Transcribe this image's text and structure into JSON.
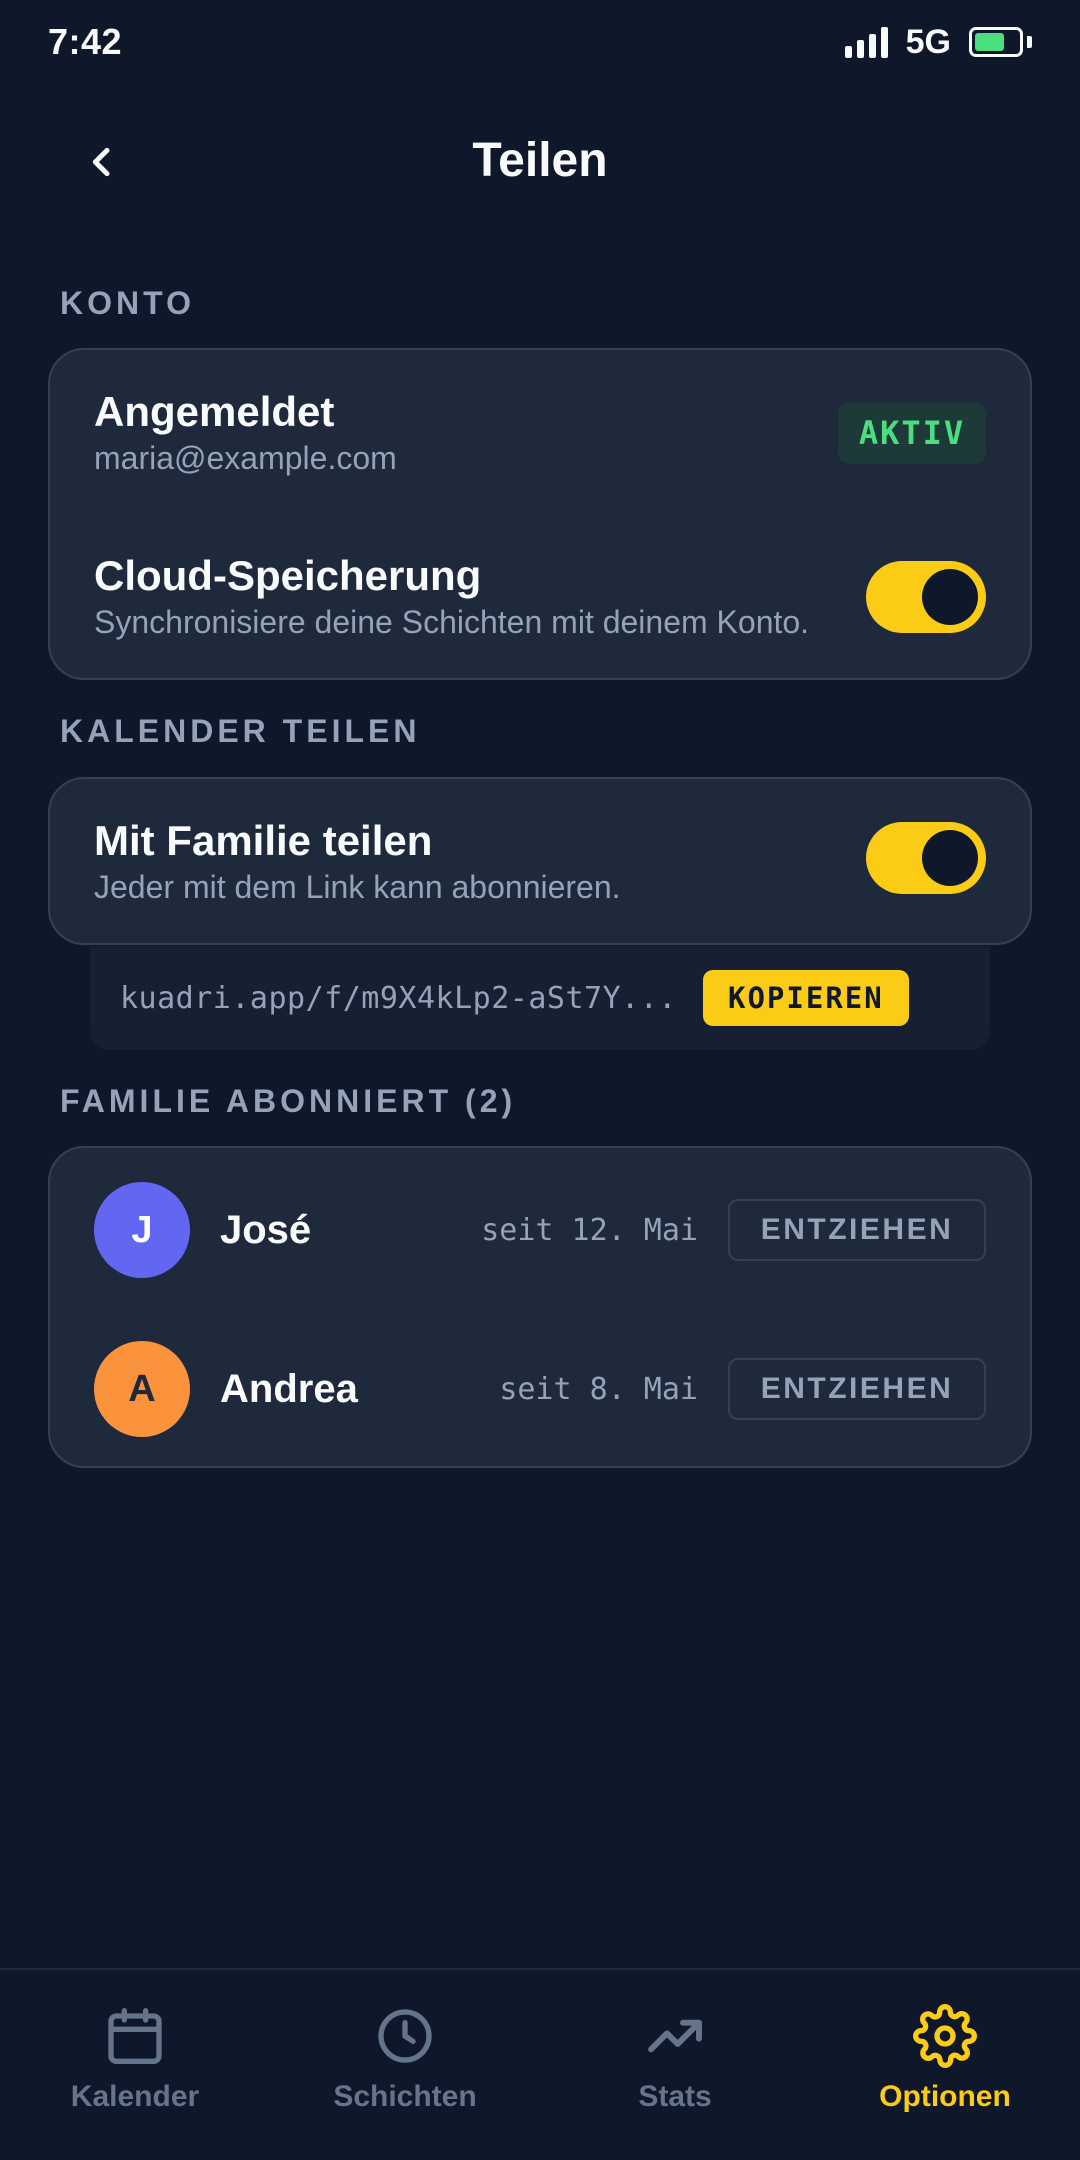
{
  "status_bar": {
    "time": "7:42",
    "network": "5G",
    "battery_level": 0.7
  },
  "header": {
    "title": "Teilen",
    "back_icon": "chevron-left-icon"
  },
  "konto": {
    "label": "KONTO",
    "signed_in_title": "Angemeldet",
    "email": "maria@example.com",
    "status_badge": "AKTIV",
    "cloud_title": "Cloud-Speicherung",
    "cloud_sub": "Synchronisiere deine Schichten mit deinem Konto.",
    "cloud_enabled": true
  },
  "kalender": {
    "label": "KALENDER TEILEN",
    "family_title": "Mit Familie teilen",
    "family_sub": "Jeder mit dem Link kann abonnieren.",
    "family_enabled": true,
    "link": "kuadri.app/f/m9X4kLp2-aSt7Y...",
    "copy_label": "KOPIEREN"
  },
  "familie": {
    "label": "FAMILIE ABONNIERT (2)",
    "members": [
      {
        "initial": "J",
        "name": "José",
        "since": "seit 12. Mai",
        "action": "ENTZIEHEN",
        "color": "#6366f1",
        "initial_color": "#ffffff"
      },
      {
        "initial": "A",
        "name": "Andrea",
        "since": "seit 8. Mai",
        "action": "ENTZIEHEN",
        "color": "#fb923c",
        "initial_color": "#1e293b"
      }
    ]
  },
  "nav": {
    "items": [
      {
        "label": "Kalender",
        "icon": "calendar-icon",
        "active": false
      },
      {
        "label": "Schichten",
        "icon": "clock-icon",
        "active": false
      },
      {
        "label": "Stats",
        "icon": "trending-up-icon",
        "active": false
      },
      {
        "label": "Optionen",
        "icon": "gear-icon",
        "active": true
      }
    ]
  },
  "colors": {
    "background": "#0f172a",
    "card": "#1e293b",
    "accent": "#facc15",
    "success": "#4ade80",
    "muted": "#94a3b8"
  }
}
